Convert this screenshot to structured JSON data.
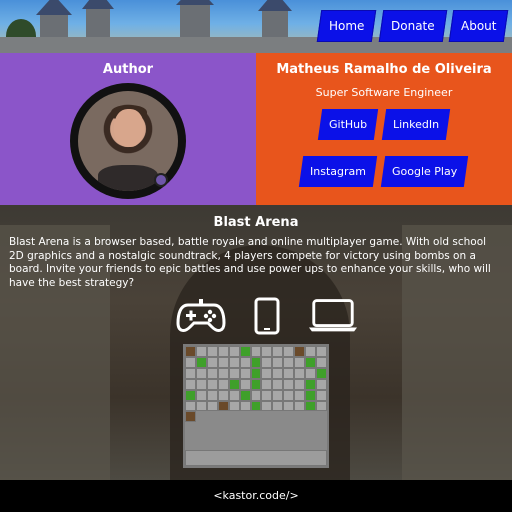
{
  "nav": {
    "items": [
      {
        "label": "Home"
      },
      {
        "label": "Donate"
      },
      {
        "label": "About"
      }
    ]
  },
  "author": {
    "label": "Author",
    "name": "Matheus Ramalho de Oliveira",
    "role": "Super Software Engineer",
    "links": [
      {
        "label": "GitHub"
      },
      {
        "label": "LinkedIn"
      },
      {
        "label": "Instagram"
      },
      {
        "label": "Google Play"
      }
    ]
  },
  "game": {
    "title": "Blast Arena",
    "description": "Blast Arena is a browser based, battle royale and online multiplayer game. With old school 2D graphics and a nostalgic soundtrack, 4 players compete for victory using bombs on a board. Invite your friends to epic battles and use power ups to enhance your skills, who will have the best strategy?",
    "platforms": [
      "gamepad-icon",
      "smartphone-icon",
      "laptop-icon"
    ]
  },
  "footer": {
    "text": "<kastor.code/>"
  },
  "colors": {
    "nav_button": "#0b11e8",
    "author_left": "#8b55c9",
    "author_right": "#e8551c",
    "footer": "#000000"
  }
}
